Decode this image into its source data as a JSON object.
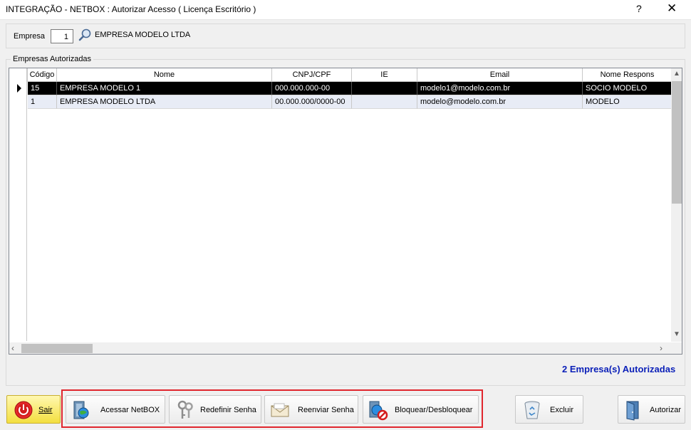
{
  "window": {
    "title": "INTEGRAÇÃO - NETBOX : Autorizar Acesso ( Licença Escritório )",
    "help_label": "?",
    "close_label": "✕"
  },
  "empresa": {
    "label": "Empresa",
    "value": "1",
    "name": "EMPRESA MODELO LTDA"
  },
  "group": {
    "title": "Empresas Autorizadas"
  },
  "grid": {
    "columns": [
      "Código",
      "Nome",
      "CNPJ/CPF",
      "IE",
      "Email",
      "Nome Respons"
    ],
    "rows": [
      {
        "codigo": "15",
        "nome": "EMPRESA MODELO 1",
        "cnpj": "000.000.000-00",
        "ie": "",
        "email": "modelo1@modelo.com.br",
        "responsavel": "SOCIO MODELO"
      },
      {
        "codigo": "1",
        "nome": "EMPRESA MODELO LTDA",
        "cnpj": "00.000.000/0000-00",
        "ie": "",
        "email": "modelo@modelo.com.br",
        "responsavel": "MODELO"
      }
    ]
  },
  "status_text": "2 Empresa(s) Autorizadas",
  "buttons": {
    "sair": "Sair",
    "acessar": "Acessar NetBOX",
    "redefinir": "Redefinir Senha",
    "reenviar": "Reenviar Senha",
    "bloquear": "Bloquear/Desbloquear",
    "excluir": "Excluir",
    "autorizar": "Autorizar"
  },
  "colors": {
    "status": "#0a1fb8",
    "highlight_border": "#e0262d",
    "selected_row": "#000000"
  }
}
